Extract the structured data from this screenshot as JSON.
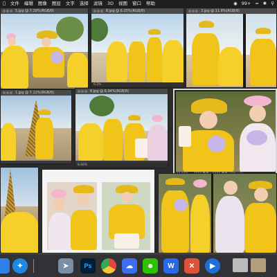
{
  "menubar": {
    "items": [
      "文件",
      "编辑",
      "图像",
      "图层",
      "文字",
      "选择",
      "滤镜",
      "3D",
      "视图",
      "窗口",
      "帮助"
    ],
    "battery": "99+",
    "status_icons": [
      "wifi-icon",
      "bluetooth-icon",
      "search-icon"
    ]
  },
  "windows": [
    {
      "title": "5.jpg @ 7.29%(RGB/8)"
    },
    {
      "title": "8.jpg @ 6.25%(RGB/8)"
    },
    {
      "title": "1.jpg @ 7.12%(RGB/8)"
    },
    {
      "title": "3.jpg @ 11.8%(RGB/8)"
    },
    {
      "title": "6.jpg @ 6.94%(RGB/8)"
    }
  ],
  "zoom_labels": {
    "a": "6.2%",
    "b": "6.66%",
    "main": "11.59%",
    "main_doc": "7659 像素 x 6468 像素 (300 ppi)"
  },
  "dock": {
    "colors": {
      "finder": "#2f7fe6",
      "safari": "#1e88e5",
      "launch": "#7b8ea8",
      "ps": "#001e36",
      "chrome": "#e3463b",
      "baidu": "#3d6ef0",
      "wechat": "#2dc100",
      "ww": "#2b68e8",
      "xd": "#e0523a",
      "quick": "#1e6fd6"
    }
  }
}
